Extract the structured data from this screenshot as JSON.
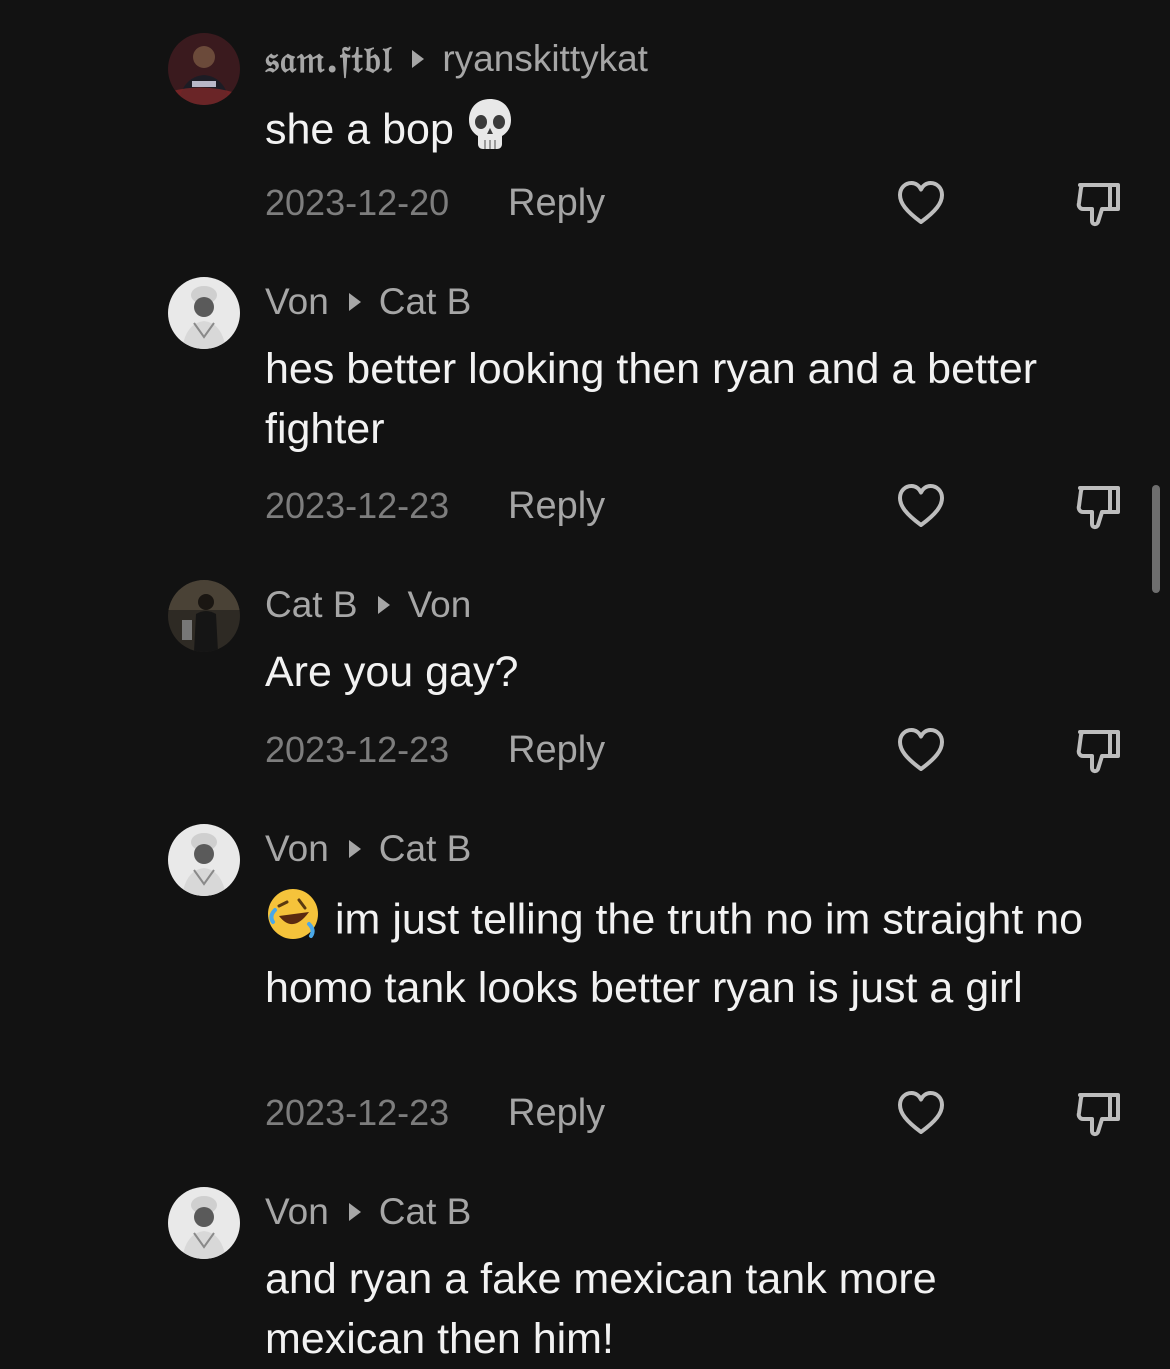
{
  "comments": [
    {
      "author": "𝔰𝔞𝔪.𝔣𝔱𝔟𝔩",
      "reply_to": "ryanskittykat",
      "text": "she a bop",
      "emoji_after": "skull-emoji",
      "date": "2023-12-20",
      "reply_label": "Reply",
      "avatar": "soccer-player-avatar"
    },
    {
      "author": "Von",
      "reply_to": "Cat B",
      "text": "hes better looking then ryan and a better fighter",
      "date": "2023-12-23",
      "reply_label": "Reply",
      "avatar": "grayscale-portrait-avatar"
    },
    {
      "author": "Cat B",
      "reply_to": "Von",
      "text": "Are you gay?",
      "date": "2023-12-23",
      "reply_label": "Reply",
      "avatar": "mirror-selfie-avatar"
    },
    {
      "author": "Von",
      "reply_to": "Cat B",
      "emoji_before": "rolling-laughing-emoji",
      "text": "im just telling the truth no im straight no homo tank looks better ryan is just a girl",
      "date": "2023-12-23",
      "reply_label": "Reply",
      "avatar": "grayscale-portrait-avatar"
    },
    {
      "author": "Von",
      "reply_to": "Cat B",
      "text": "and ryan a fake mexican tank more mexican then him!",
      "avatar": "grayscale-portrait-avatar"
    }
  ],
  "colors": {
    "background": "#121212",
    "author": "#a6a6a6",
    "body": "#f2f2f2",
    "date": "#7d7d7d",
    "icon": "#bdbdbd"
  }
}
